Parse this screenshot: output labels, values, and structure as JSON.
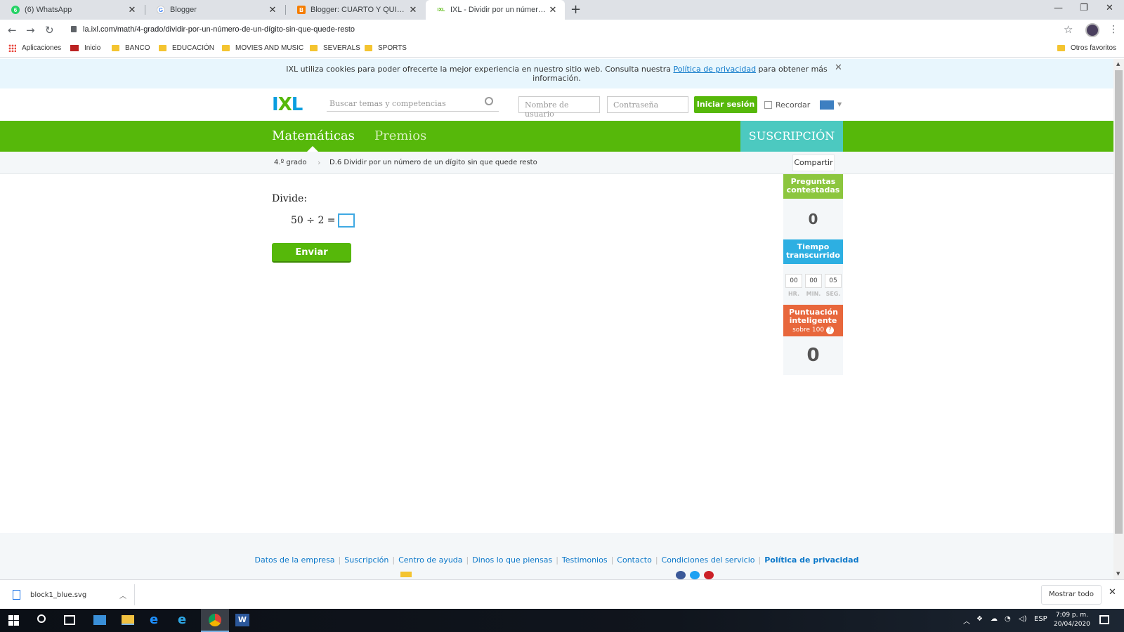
{
  "browser": {
    "tabs": [
      {
        "title": "(6) WhatsApp",
        "active": false
      },
      {
        "title": "Blogger",
        "active": false
      },
      {
        "title": "Blogger: CUARTO Y QUINTO I.E. F",
        "active": false
      },
      {
        "title": "IXL - Dividir por un número de u",
        "active": true
      }
    ],
    "url": "la.ixl.com/math/4-grado/dividir-por-un-número-de-un-dígito-sin-que-quede-resto",
    "bookmarks": [
      "Aplicaciones",
      "Inicio",
      "BANCO",
      "EDUCACIÓN",
      "MOVIES AND MUSIC",
      "SEVERALS",
      "SPORTS"
    ],
    "other_bookmarks": "Otros favoritos"
  },
  "cookie": {
    "text_before": "IXL utiliza cookies para poder ofrecerte la mejor experiencia en nuestro sitio web. Consulta nuestra ",
    "link": "Política de privacidad",
    "text_after": " para obtener más",
    "line2": "información."
  },
  "header": {
    "logo": "IXL",
    "search_placeholder": "Buscar temas y competencias",
    "username_placeholder": "Nombre de usuario",
    "password_placeholder": "Contraseña",
    "login_label": "Iniciar sesión",
    "remember_label": "Recordar"
  },
  "nav": {
    "items": [
      "Matemáticas",
      "Premios"
    ],
    "subscribe": "SUSCRIPCIÓN"
  },
  "breadcrumb": {
    "grade": "4.º grado",
    "skill": "D.6 Dividir por un número de un dígito sin que quede resto",
    "share": "Compartir"
  },
  "question": {
    "prompt": "Divide:",
    "equation": "50 ÷ 2 =",
    "submit_label": "Enviar"
  },
  "stats": {
    "answered_label": "Preguntas contestadas",
    "answered_value": "0",
    "time_label": "Tiempo transcurrido",
    "time": {
      "hr": "00",
      "min": "00",
      "sec": "05"
    },
    "time_units": {
      "hr": "HR.",
      "min": "MIN.",
      "sec": "SEG."
    },
    "smartscore_label": "Puntuación inteligente",
    "smartscore_sub": "sobre 100",
    "smartscore_value": "0",
    "colors": {
      "answered": "#8cc63e",
      "time": "#2dafe2",
      "score": "#e8673c"
    }
  },
  "footer": {
    "links": [
      "Datos de la empresa",
      "Suscripción",
      "Centro de ayuda",
      "Dinos lo que piensas",
      "Testimonios",
      "Contacto",
      "Condiciones del servicio"
    ],
    "privacy": "Política de privacidad"
  },
  "downloads": {
    "file": "block1_blue.svg",
    "show_all": "Mostrar todo"
  },
  "taskbar": {
    "lang": "ESP",
    "time": "7:09 p. m.",
    "date": "20/04/2020"
  }
}
